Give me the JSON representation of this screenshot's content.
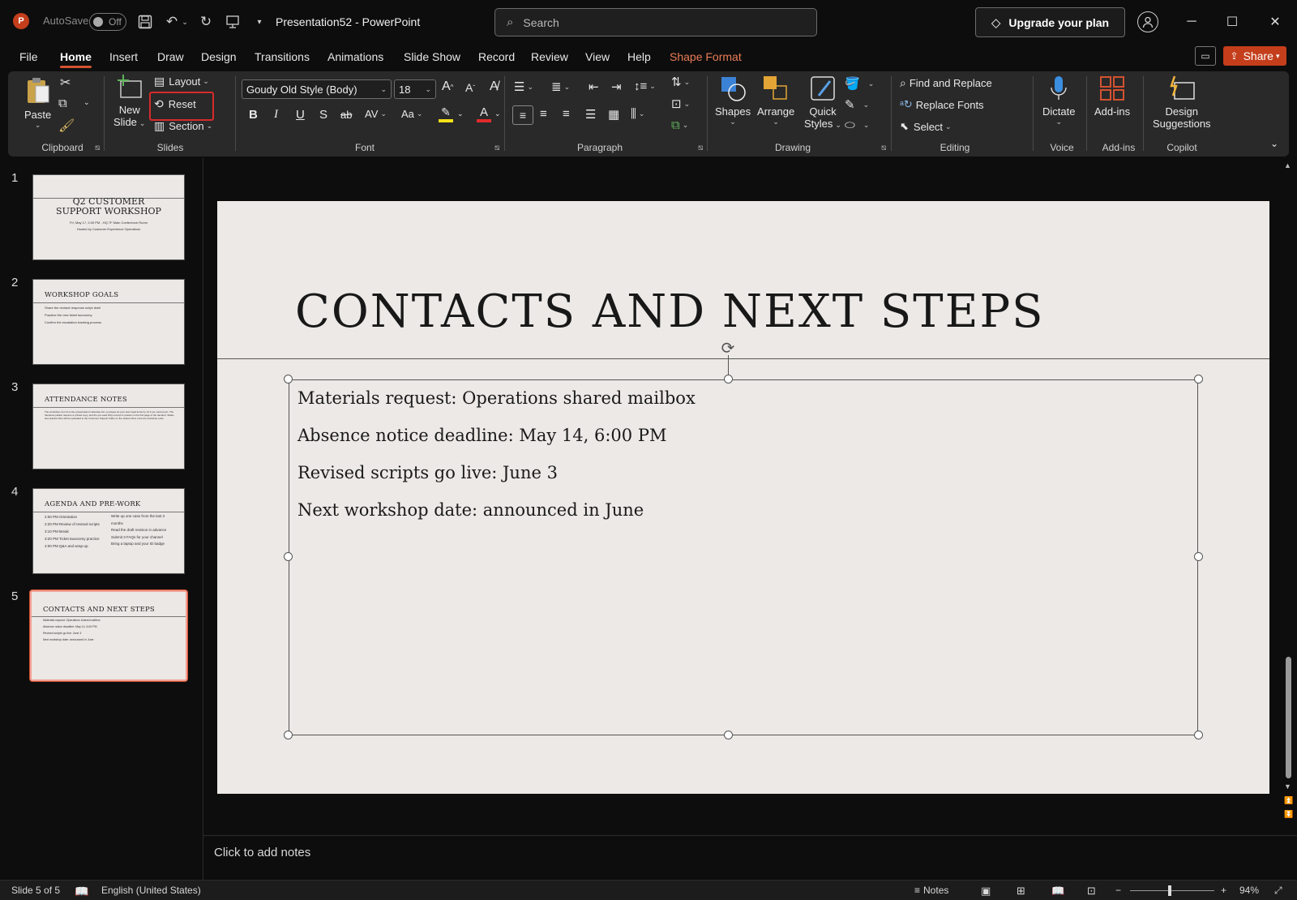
{
  "titlebar": {
    "autosave_label": "AutoSave",
    "autosave_state": "Off",
    "doc_title": "Presentation52  -  PowerPoint",
    "search_placeholder": "Search",
    "upgrade_label": "Upgrade your plan",
    "minimize_glyph": "─",
    "maximize_glyph": "☐",
    "close_glyph": "✕"
  },
  "menu": {
    "file": "File",
    "home": "Home",
    "insert": "Insert",
    "draw": "Draw",
    "design": "Design",
    "transitions": "Transitions",
    "animations": "Animations",
    "slideshow": "Slide Show",
    "record": "Record",
    "review": "Review",
    "view": "View",
    "help": "Help",
    "shape_format": "Shape Format",
    "share": "Share"
  },
  "ribbon": {
    "clipboard": {
      "paste": "Paste",
      "group": "Clipboard"
    },
    "slides": {
      "new_slide_1": "New",
      "new_slide_2": "Slide",
      "layout": "Layout",
      "reset": "Reset",
      "section": "Section",
      "group": "Slides"
    },
    "font": {
      "font_name": "Goudy Old Style (Body)",
      "font_size": "18",
      "bold": "B",
      "italic": "I",
      "underline": "U",
      "shadow": "S",
      "strike": "ab",
      "spacing": "AV",
      "case": "Aa",
      "group": "Font"
    },
    "paragraph": {
      "group": "Paragraph"
    },
    "drawing": {
      "shapes": "Shapes",
      "arrange": "Arrange",
      "quick_1": "Quick",
      "quick_2": "Styles",
      "group": "Drawing"
    },
    "editing": {
      "find_replace": "Find and Replace",
      "replace_fonts": "Replace Fonts",
      "select": "Select",
      "group": "Editing"
    },
    "voice": {
      "dictate": "Dictate",
      "group": "Voice"
    },
    "addins": {
      "addins": "Add-ins",
      "group": "Add-ins"
    },
    "copilot": {
      "design_1": "Design",
      "design_2": "Suggestions",
      "group": "Copilot"
    }
  },
  "thumbnails": [
    {
      "num": "1",
      "title_1": "Q2 CUSTOMER",
      "title_2": "SUPPORT WORKSHOP",
      "sub_1": "Fri, May 17, 2:00 PM - HQ 7F Main Conference Room",
      "sub_2": "Hosted by Customer Experience Operations"
    },
    {
      "num": "2",
      "title": "WORKSHOP GOALS",
      "lines": [
        "Share the revised response script draft",
        "Practice the new ticket taxonomy",
        "Confirm the escalation tracking process"
      ]
    },
    {
      "num": "3",
      "title": "ATTENDANCE NOTES",
      "body": "The workshop runs from the presentation's attendee list, so please let your team lead know by 14 if you cannot join. The handouts packet requires a printed copy, and the pre-read FAQ excerpt is posted on the first page of the handout. Slides and practice files will be uploaded to the Customer Support folder on the shared drive once the workshop ends."
    },
    {
      "num": "4",
      "title": "AGENDA AND PRE-WORK",
      "left": [
        "2:00 PM Orientation",
        "2:20 PM Review of revised scripts",
        "3:10 PM Break",
        "3:20 PM Ticket taxonomy practice",
        "4:00 PM Q&A and wrap-up"
      ],
      "right": [
        "Write up one case from the last 3 months",
        "Read the draft revision in advance",
        "Submit 3 FAQs for your channel",
        "Bring a laptop and your ID badge"
      ]
    },
    {
      "num": "5",
      "title": "CONTACTS AND NEXT STEPS",
      "lines": [
        "Materials request: Operations shared mailbox",
        "Absence notice deadline: May 14, 6:00 PM",
        "Revised scripts go live: June 3",
        "Next workshop date: announced in June"
      ]
    }
  ],
  "slide": {
    "title": "CONTACTS AND NEXT STEPS",
    "lines": [
      "Materials request: Operations shared mailbox",
      "Absence notice deadline: May 14, 6:00 PM",
      "Revised scripts go live: June 3",
      "Next workshop date: announced in June"
    ]
  },
  "notes": {
    "placeholder": "Click to add notes"
  },
  "status": {
    "slide_counter": "Slide 5 of 5",
    "language": "English (United States)",
    "notes": "Notes",
    "zoom": "94%",
    "minus": "−",
    "plus": "+"
  },
  "colors": {
    "accent": "#d35230",
    "highlight_box": "#d62b2b",
    "slide_bg": "#ece9e6"
  }
}
